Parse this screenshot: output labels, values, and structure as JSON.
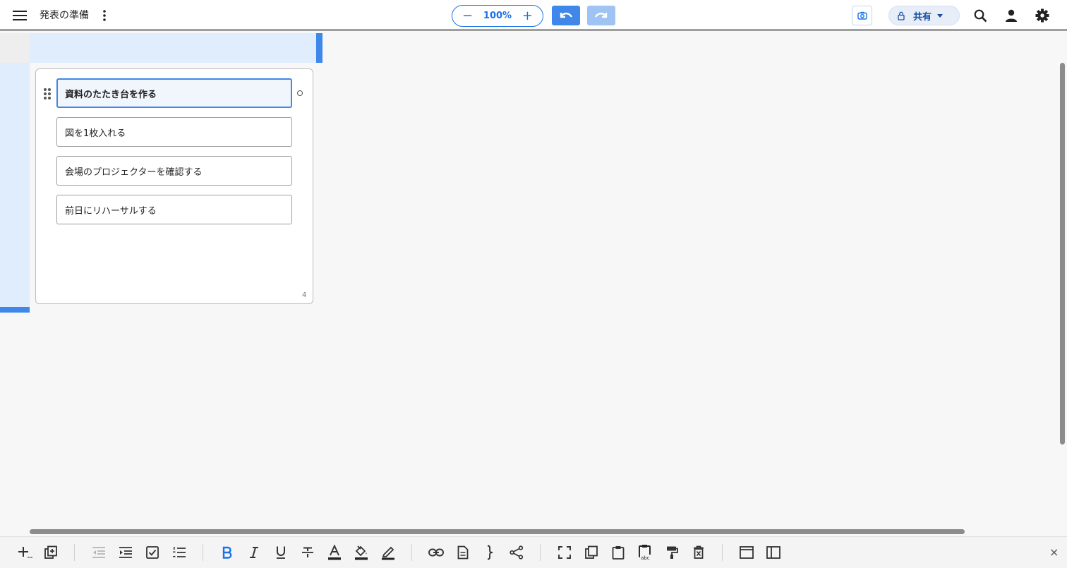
{
  "header": {
    "doc_title": "発表の準備",
    "zoom_level": "100%",
    "zoom_minus": "−",
    "zoom_plus": "+",
    "share_label": "共有"
  },
  "card": {
    "items": [
      {
        "text": "資料のたたき台を作る"
      },
      {
        "text": "図を1枚入れる"
      },
      {
        "text": "会場のプロジェクターを確認する"
      },
      {
        "text": "前日にリハーサルする"
      }
    ],
    "item_count": "4"
  },
  "toolbar": {
    "close_symbol": "×"
  },
  "colors": {
    "accent": "#3f87e8",
    "selection": "#e0edfc",
    "share_text": "#174ea6"
  }
}
